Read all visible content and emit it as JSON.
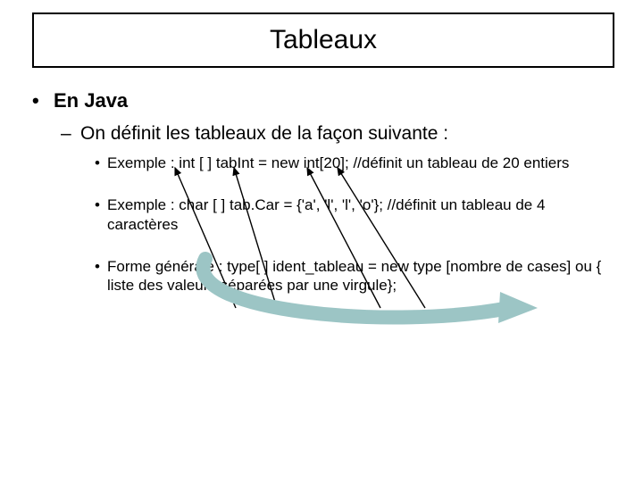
{
  "title": "Tableaux",
  "heading": "En Java",
  "subheading": "On définit les tableaux de la façon suivante :",
  "bullets": [
    "Exemple : int [ ] tabInt = new int[20];  //définit un tableau de 20 entiers",
    "Exemple : char [ ] tab.Car = {'a', 'l', 'l', 'o'};  //définit un tableau de 4 caractères",
    "Forme générale : type[ ] ident_tableau = new type [nombre de cases] ou { liste des valeurs séparées par une virgule};"
  ]
}
